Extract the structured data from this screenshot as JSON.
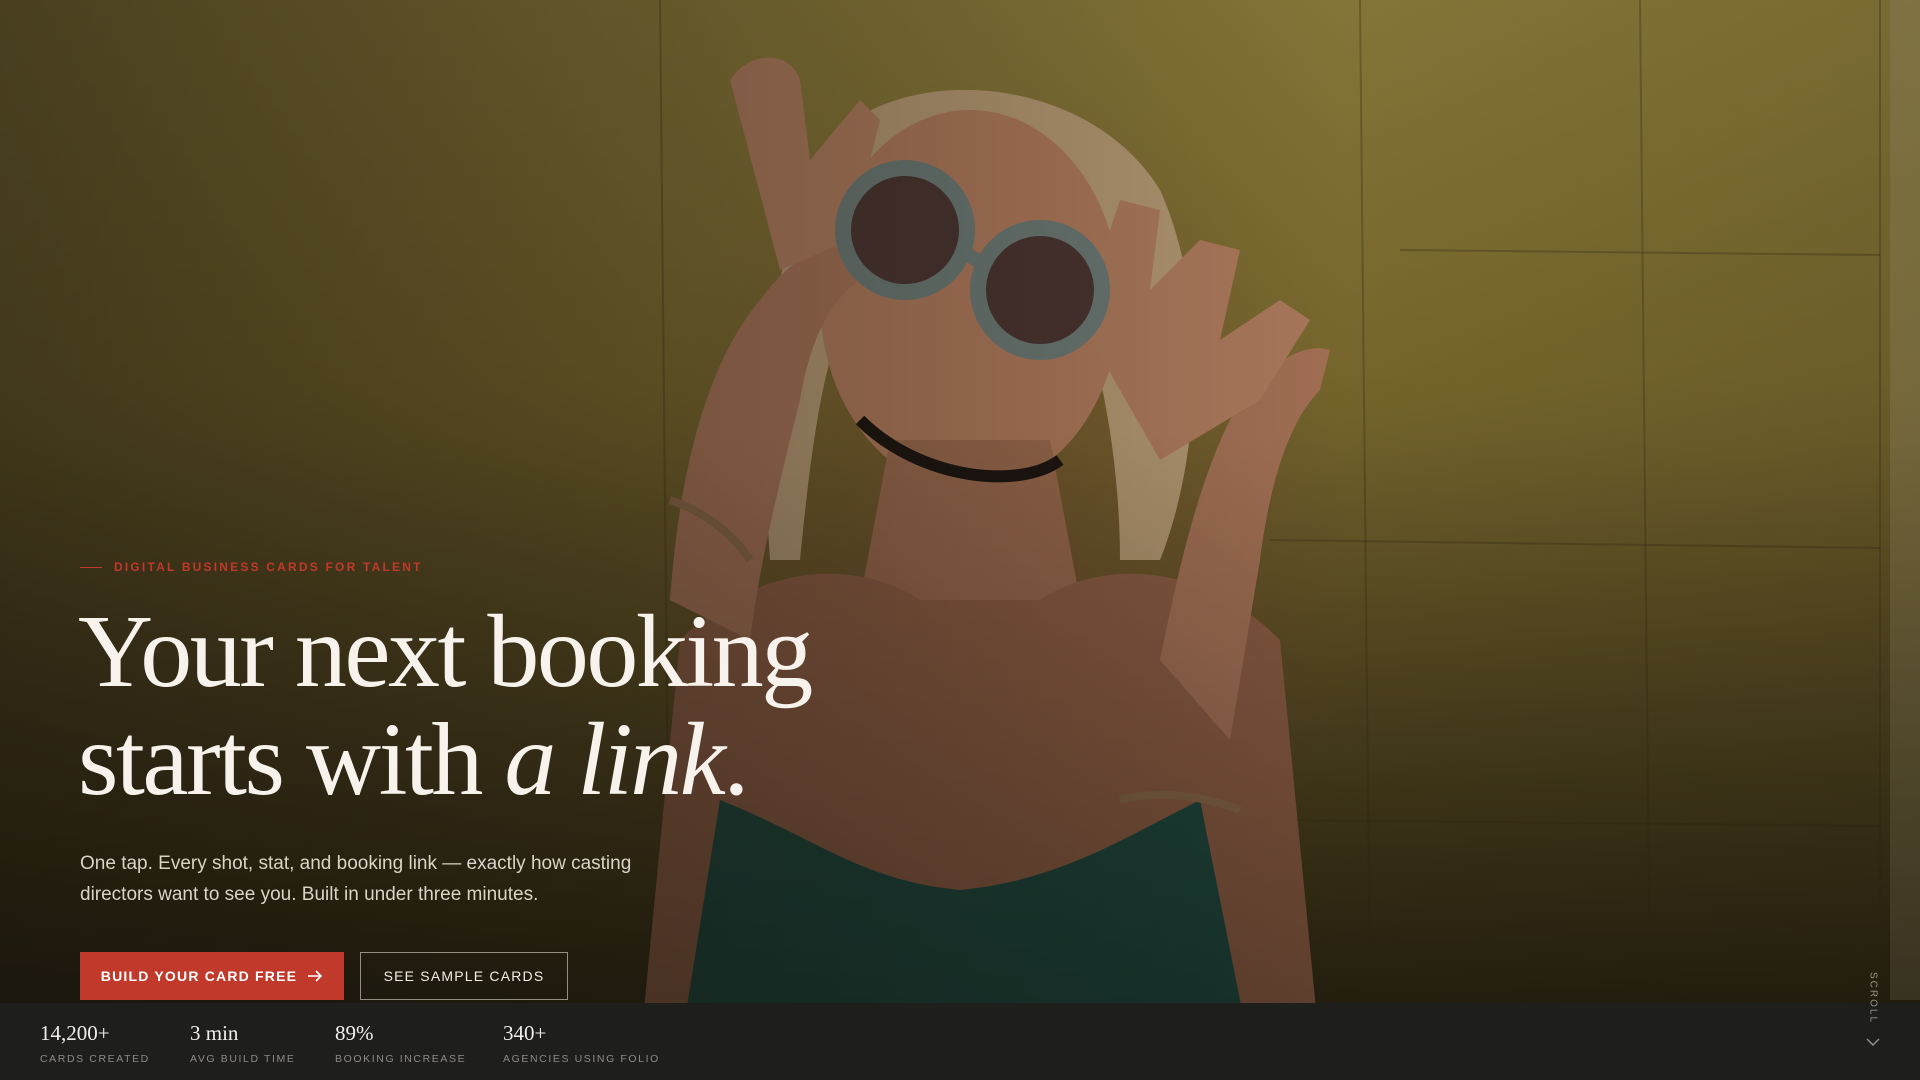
{
  "hero": {
    "eyebrow": "DIGITAL BUSINESS CARDS FOR TALENT",
    "headline_line1": "Your next booking",
    "headline_line2_plain": "starts with ",
    "headline_line2_italic": "a link",
    "headline_line2_end": ".",
    "subtext": "One tap. Every shot, stat, and booking link — exactly how casting directors want to see you. Built in under three minutes.",
    "primary_cta": "BUILD YOUR CARD FREE",
    "secondary_cta": "SEE SAMPLE CARDS",
    "scroll_label": "SCROLL"
  },
  "stats": [
    {
      "value": "14,200+",
      "label": "CARDS CREATED"
    },
    {
      "value": "3 min",
      "label": "AVG BUILD TIME"
    },
    {
      "value": "89%",
      "label": "BOOKING INCREASE"
    },
    {
      "value": "340+",
      "label": "AGENCIES USING FOLIO"
    }
  ],
  "colors": {
    "accent": "#c0392b",
    "stats_bar": "#1e1e1c",
    "headline": "#f7f3ec"
  },
  "icons": {
    "cta_arrow": "arrow-right-icon",
    "scroll": "chevron-down-icon"
  }
}
